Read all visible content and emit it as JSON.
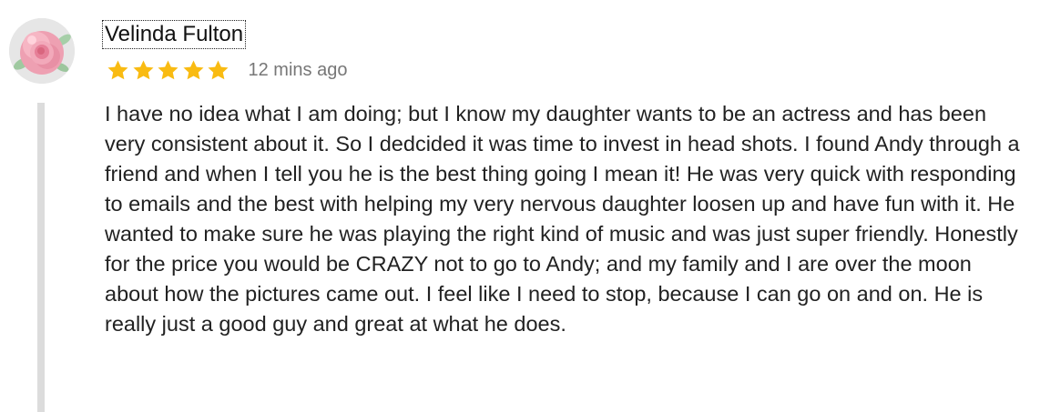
{
  "review": {
    "reviewer_name": "Velinda Fulton",
    "rating": 5,
    "rating_max": 5,
    "time_ago": "12 mins ago",
    "text": "I have no idea what I am doing; but I know my daughter wants to be an actress and has been very consistent about it. So I dedcided it was time to invest in head shots. I found Andy through a friend and when I tell you he is the best thing going I mean it! He was very quick with responding to emails and the best with helping my very nervous daughter loosen up and have fun with it. He wanted to make sure he was playing the right kind of music and was just super friendly. Honestly for the price you would be CRAZY not to go to Andy; and my family and I are over the moon about how the pictures came out. I feel like I need to stop, because I can go on and on. He is really just a good guy and great at what he does."
  },
  "icons": {
    "avatar": "rose-avatar",
    "rating_star": "star-icon"
  },
  "colors": {
    "star": "#f9bb12",
    "time_text": "#777777",
    "thread_line": "#dcdcdc",
    "avatar_rose": "#f2a2b4"
  }
}
